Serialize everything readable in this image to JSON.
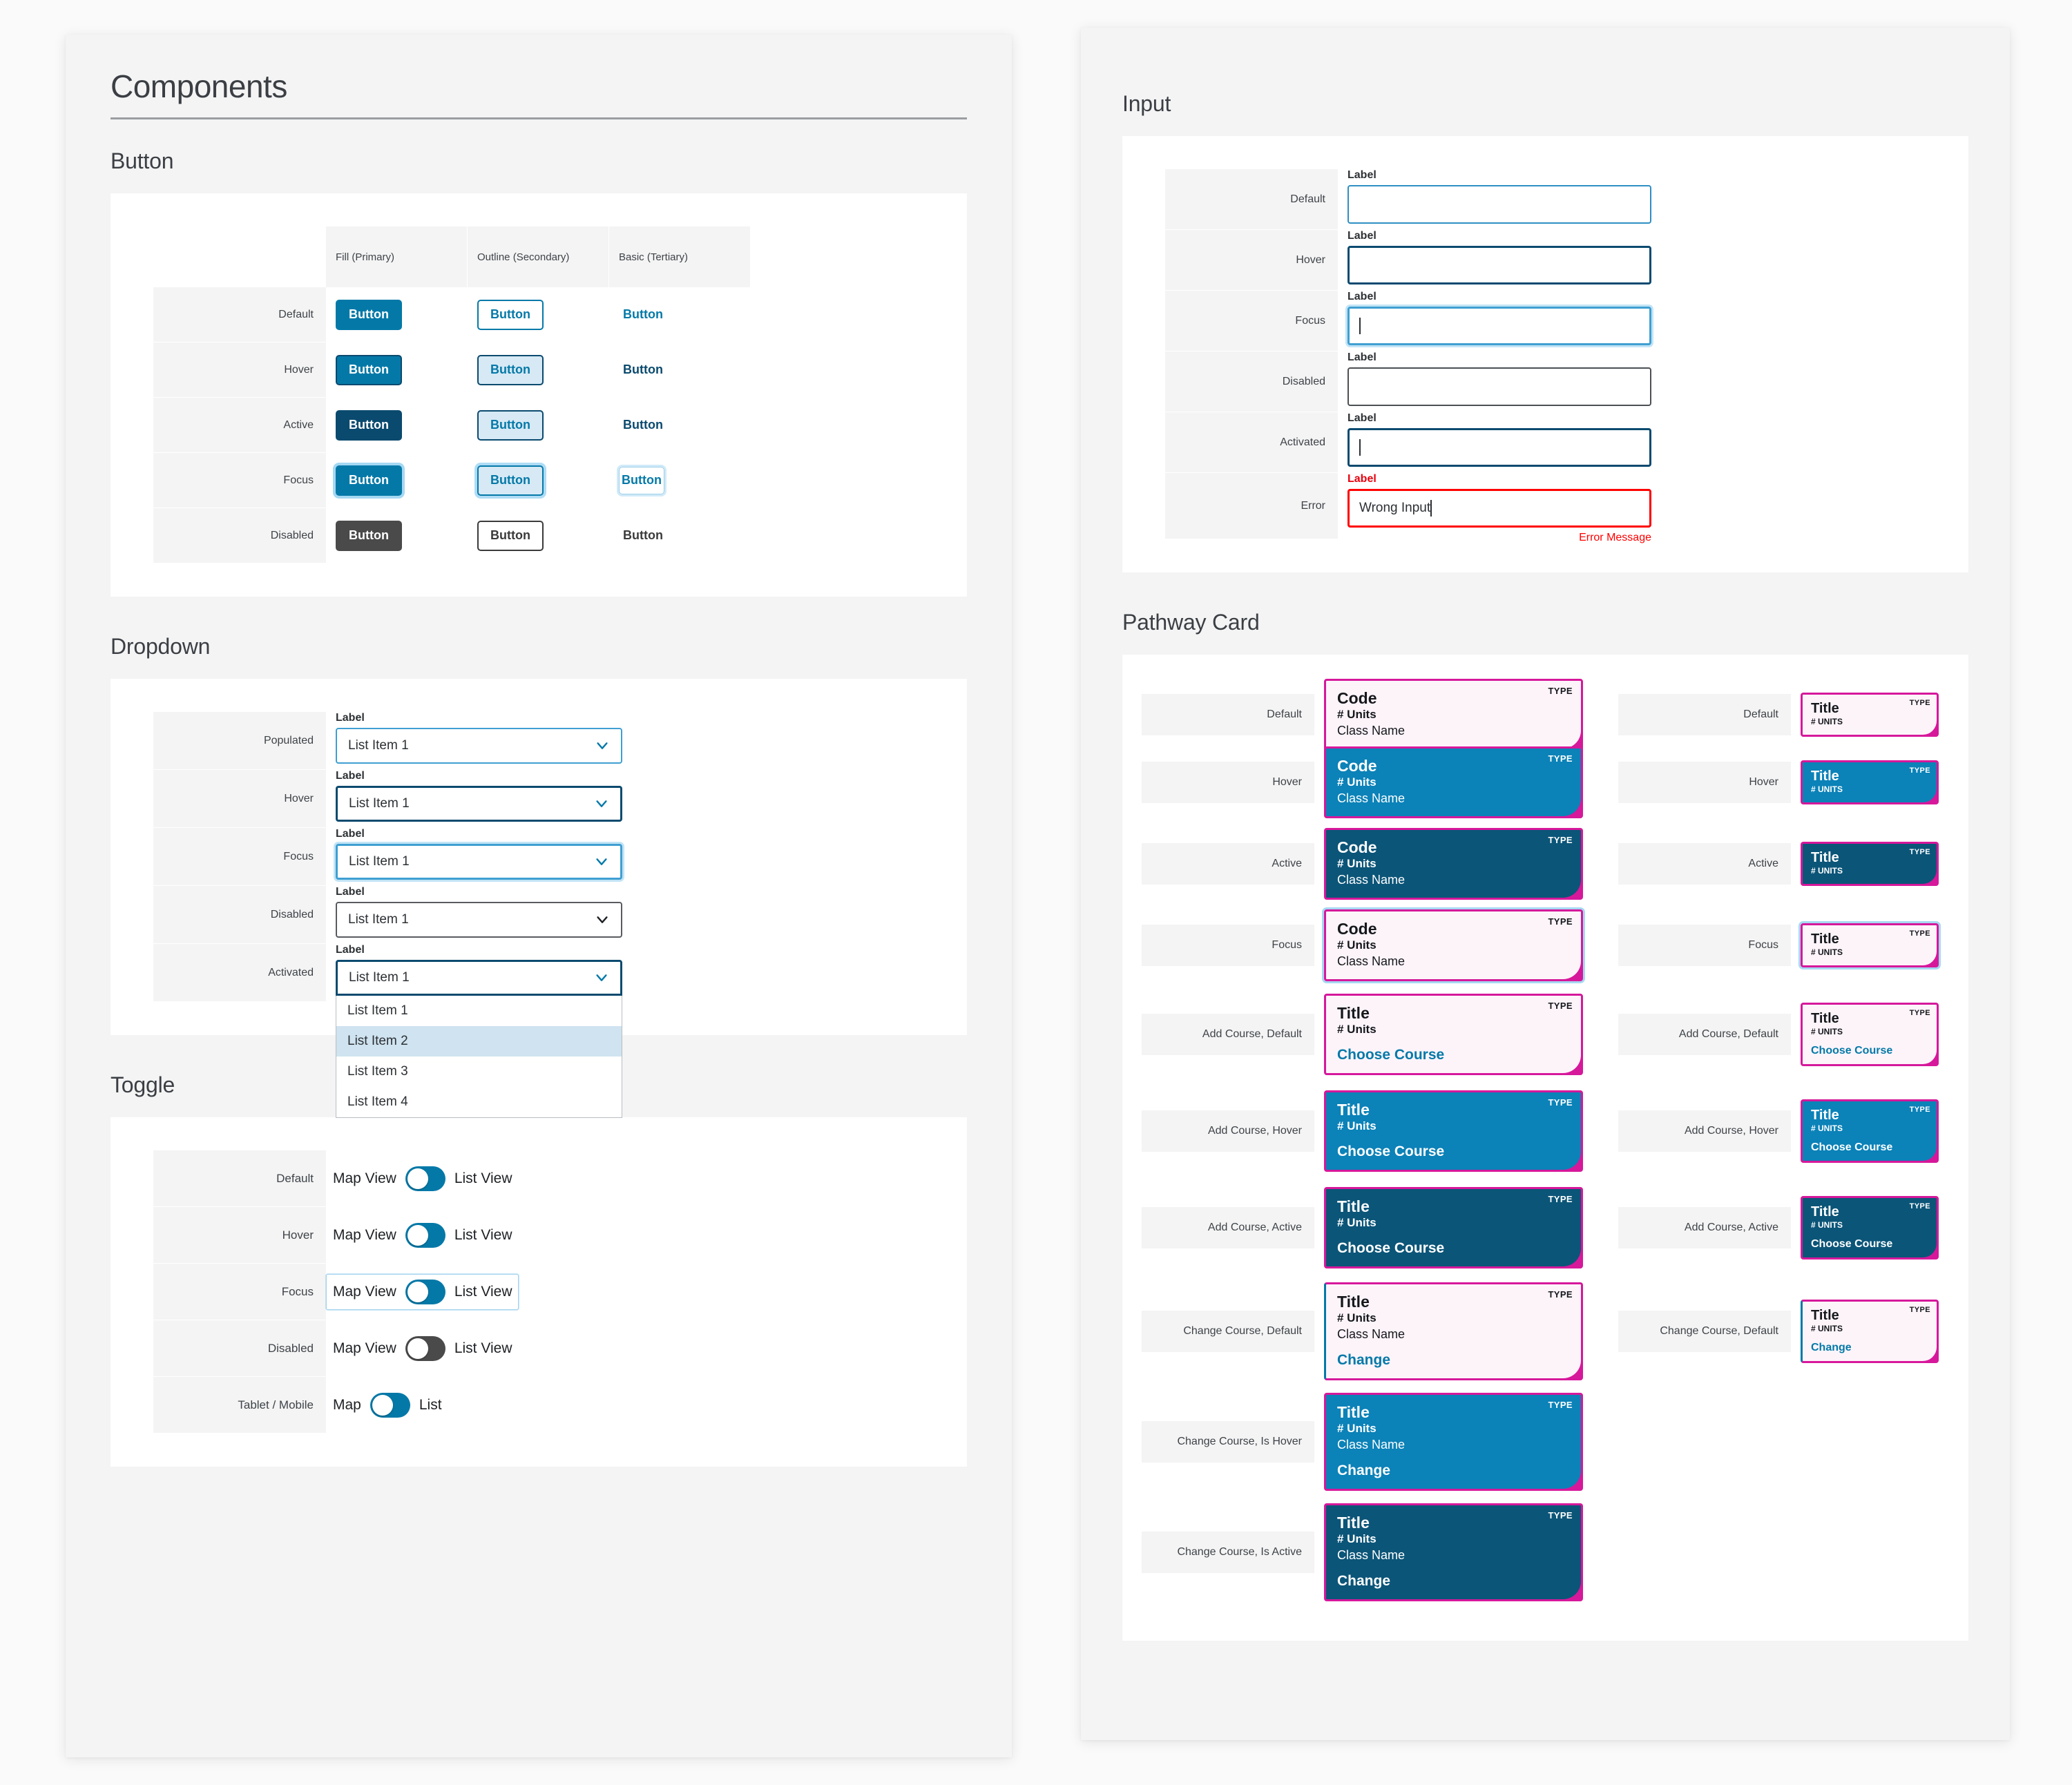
{
  "left_panel": {
    "page_title": "Components",
    "button_section": {
      "title": "Button",
      "columns": [
        "Fill (Primary)",
        "Outline (Secondary)",
        "Basic (Tertiary)"
      ],
      "rows": [
        {
          "state": "Default",
          "fill": "Button",
          "outline": "Button",
          "basic": "Button"
        },
        {
          "state": "Hover",
          "fill": "Button",
          "outline": "Button",
          "basic": "Button"
        },
        {
          "state": "Active",
          "fill": "Button",
          "outline": "Button",
          "basic": "Button"
        },
        {
          "state": "Focus",
          "fill": "Button",
          "outline": "Button",
          "basic": "Button"
        },
        {
          "state": "Disabled",
          "fill": "Button",
          "outline": "Button",
          "basic": "Button"
        }
      ]
    },
    "dropdown_section": {
      "title": "Dropdown",
      "rows": [
        {
          "state": "Populated",
          "label": "Label",
          "value": "List Item 1"
        },
        {
          "state": "Hover",
          "label": "Label",
          "value": "List Item 1"
        },
        {
          "state": "Focus",
          "label": "Label",
          "value": "List Item 1"
        },
        {
          "state": "Disabled",
          "label": "Label",
          "value": "List Item 1"
        },
        {
          "state": "Activated",
          "label": "Label",
          "value": "List Item 1"
        }
      ],
      "menu_options": [
        "List Item 1",
        "List Item 2",
        "List Item 3",
        "List Item 4"
      ],
      "menu_selected_index": 1
    },
    "toggle_section": {
      "title": "Toggle",
      "rows": [
        {
          "state": "Default",
          "left_label": "Map View",
          "right_label": "List View"
        },
        {
          "state": "Hover",
          "left_label": "Map View",
          "right_label": "List View"
        },
        {
          "state": "Focus",
          "left_label": "Map View",
          "right_label": "List View"
        },
        {
          "state": "Disabled",
          "left_label": "Map View",
          "right_label": "List View"
        },
        {
          "state": "Tablet / Mobile",
          "left_label": "Map",
          "right_label": "List"
        }
      ]
    }
  },
  "right_panel": {
    "input_section": {
      "title": "Input",
      "rows": [
        {
          "state": "Default",
          "label": "Label",
          "value": ""
        },
        {
          "state": "Hover",
          "label": "Label",
          "value": ""
        },
        {
          "state": "Focus",
          "label": "Label",
          "value": ""
        },
        {
          "state": "Disabled",
          "label": "Label",
          "value": ""
        },
        {
          "state": "Activated",
          "label": "Label",
          "value": ""
        },
        {
          "state": "Error",
          "label": "Label",
          "value": "Wrong Input",
          "error_message": "Error Message"
        }
      ]
    },
    "pathway_section": {
      "title": "Pathway Card",
      "left_column": [
        {
          "state": "Default",
          "type": "TYPE",
          "title": "Code",
          "units": "# Units",
          "class_name": "Class Name",
          "action": ""
        },
        {
          "state": "Hover",
          "type": "TYPE",
          "title": "Code",
          "units": "# Units",
          "class_name": "Class Name",
          "action": ""
        },
        {
          "state": "Active",
          "type": "TYPE",
          "title": "Code",
          "units": "# Units",
          "class_name": "Class Name",
          "action": ""
        },
        {
          "state": "Focus",
          "type": "TYPE",
          "title": "Code",
          "units": "# Units",
          "class_name": "Class Name",
          "action": ""
        },
        {
          "state": "Add Course, Default",
          "type": "TYPE",
          "title": "Title",
          "units": "# Units",
          "class_name": "",
          "action": "Choose Course"
        },
        {
          "state": "Add Course, Hover",
          "type": "TYPE",
          "title": "Title",
          "units": "# Units",
          "class_name": "",
          "action": "Choose Course"
        },
        {
          "state": "Add Course, Active",
          "type": "TYPE",
          "title": "Title",
          "units": "# Units",
          "class_name": "",
          "action": "Choose Course"
        },
        {
          "state": "Change Course, Default",
          "type": "TYPE",
          "title": "Title",
          "units": "# Units",
          "class_name": "Class Name",
          "action": "Change"
        },
        {
          "state": "Change Course, Is Hover",
          "type": "TYPE",
          "title": "Title",
          "units": "# Units",
          "class_name": "Class Name",
          "action": "Change"
        },
        {
          "state": "Change Course, Is Active",
          "type": "TYPE",
          "title": "Title",
          "units": "# Units",
          "class_name": "Class Name",
          "action": "Change"
        }
      ],
      "right_column": [
        {
          "state": "Default",
          "type": "TYPE",
          "title": "Title",
          "units": "# UNITS",
          "action": ""
        },
        {
          "state": "Hover",
          "type": "TYPE",
          "title": "Title",
          "units": "# UNITS",
          "action": ""
        },
        {
          "state": "Active",
          "type": "TYPE",
          "title": "Title",
          "units": "# UNITS",
          "action": ""
        },
        {
          "state": "Focus",
          "type": "TYPE",
          "title": "Title",
          "units": "# UNITS",
          "action": ""
        },
        {
          "state": "Add Course, Default",
          "type": "TYPE",
          "title": "Title",
          "units": "# UNITS",
          "action": "Choose Course"
        },
        {
          "state": "Add Course, Hover",
          "type": "TYPE",
          "title": "Title",
          "units": "# UNITS",
          "action": "Choose Course"
        },
        {
          "state": "Add Course, Active",
          "type": "TYPE",
          "title": "Title",
          "units": "# UNITS",
          "action": "Choose Course"
        },
        {
          "state": "Change Course, Default",
          "type": "TYPE",
          "title": "Title",
          "units": "# UNITS",
          "action": "Change"
        }
      ]
    }
  },
  "colors": {
    "primary_blue": "#0479a8",
    "dark_blue": "#0b4a6f",
    "light_blue_fill": "#d6e9f5",
    "magenta": "#d6189b",
    "card_light": "#fdf4fa",
    "error_red": "#ff0000",
    "disabled_gray": "#4a4a4a",
    "panel_bg": "#f4f4f4"
  }
}
